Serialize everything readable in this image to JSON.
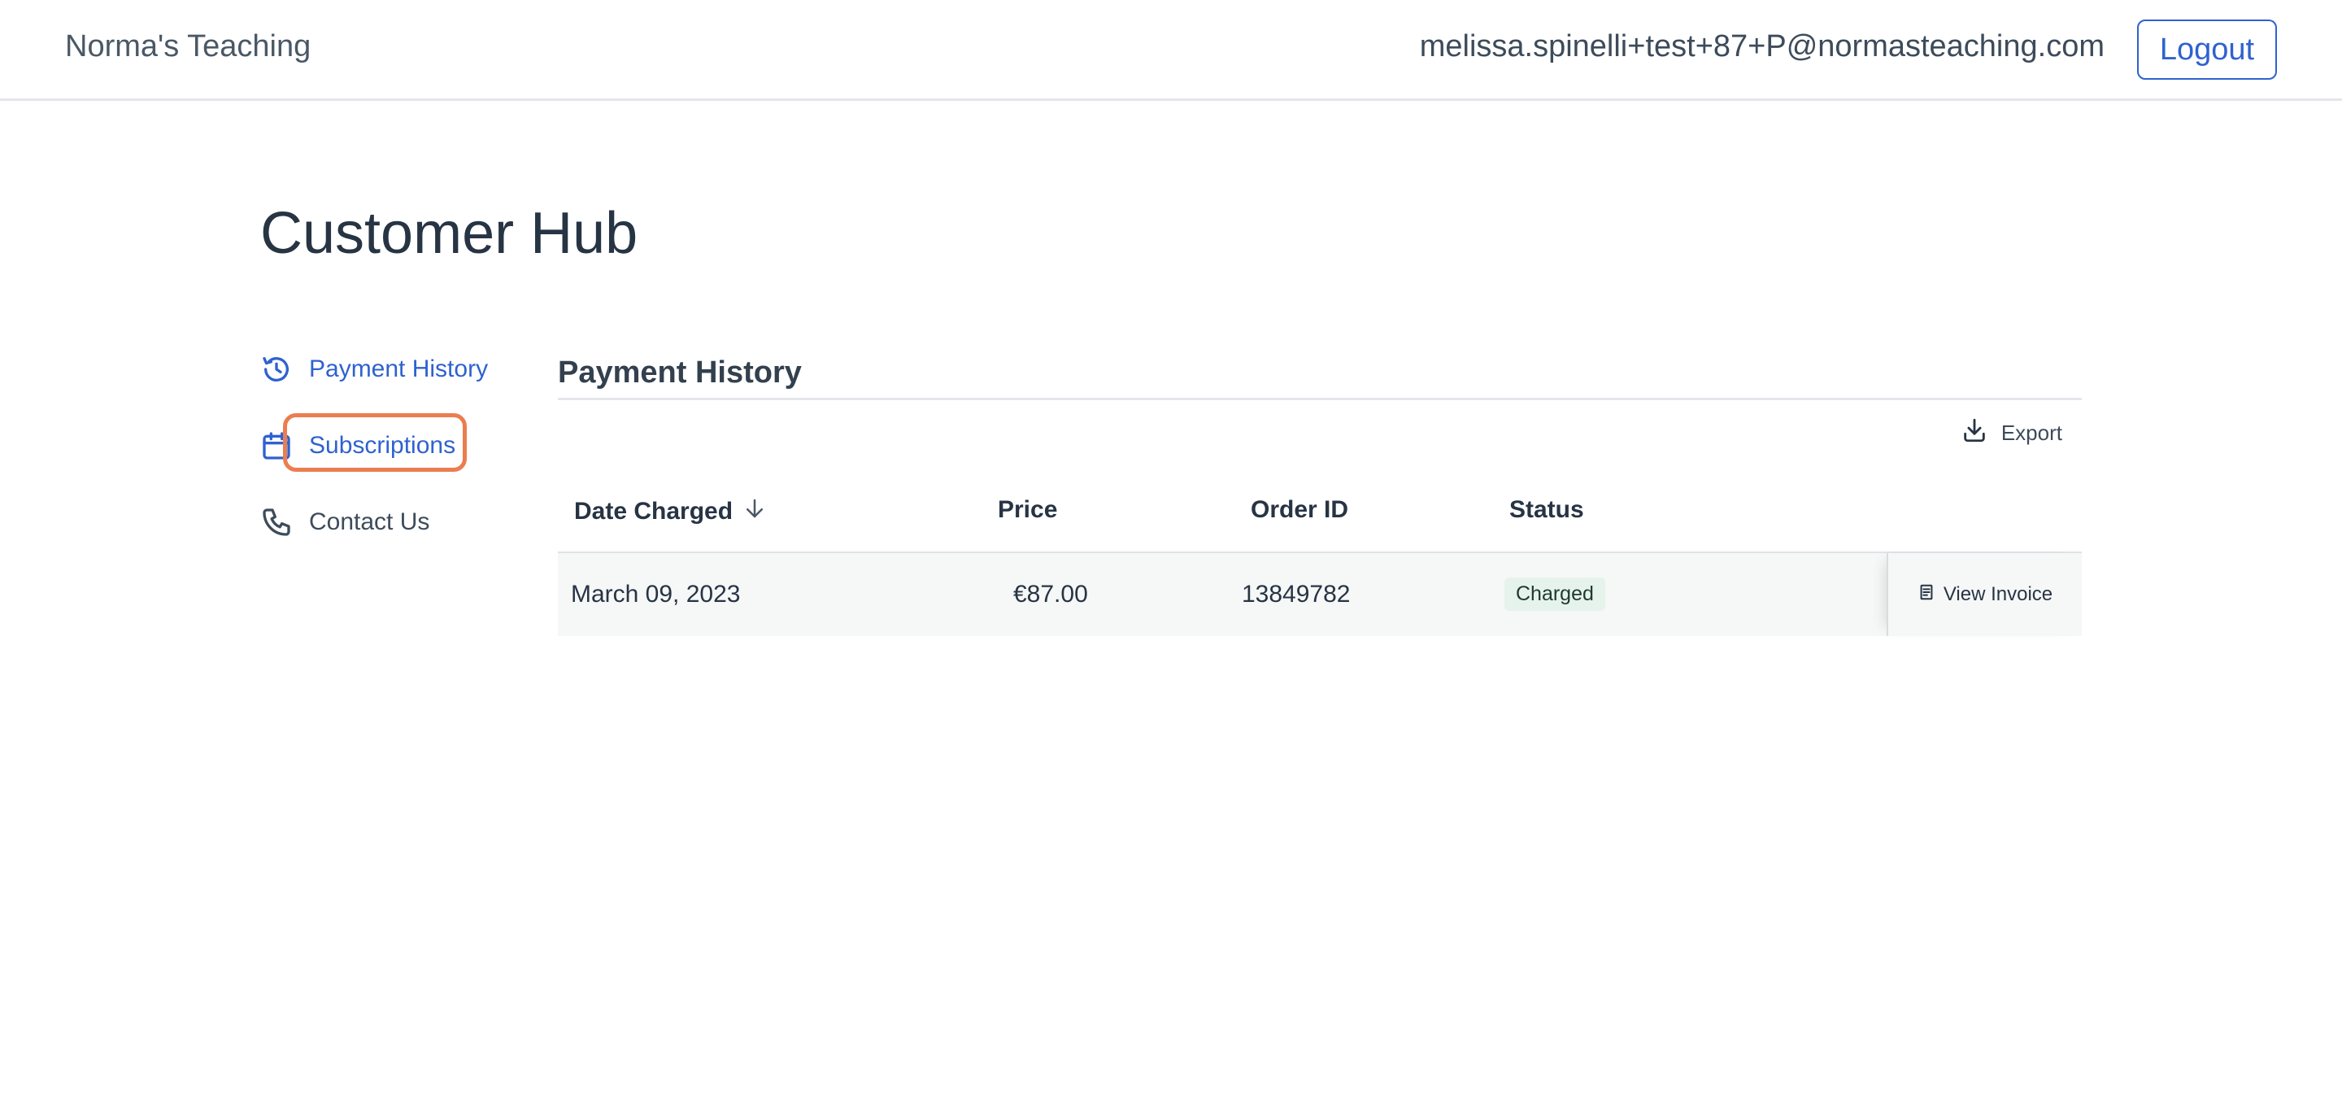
{
  "header": {
    "brand": "Norma's Teaching",
    "user_email": "melissa.spinelli+test+87+P@normasteaching.com",
    "logout_label": "Logout"
  },
  "page": {
    "title": "Customer Hub"
  },
  "sidebar": {
    "items": [
      {
        "label": "Payment History",
        "icon": "history-icon",
        "active": true
      },
      {
        "label": "Subscriptions",
        "icon": "calendar-icon",
        "active": true,
        "highlighted": true
      },
      {
        "label": "Contact Us",
        "icon": "phone-icon",
        "active": false
      }
    ]
  },
  "main": {
    "section_title": "Payment History",
    "export_label": "Export",
    "table": {
      "columns": [
        "Date Charged",
        "Price",
        "Order ID",
        "Status"
      ],
      "sort_icon": "arrow-down-icon",
      "rows": [
        {
          "date": "March 09, 2023",
          "price": "€87.00",
          "order_id": "13849782",
          "status": "Charged",
          "action": "View Invoice"
        }
      ]
    }
  },
  "colors": {
    "accent": "#2f62cf",
    "text": "#273444",
    "highlight": "#eb7d4f",
    "status_bg": "#e6f3ec",
    "row_bg": "#f6f7f7"
  }
}
